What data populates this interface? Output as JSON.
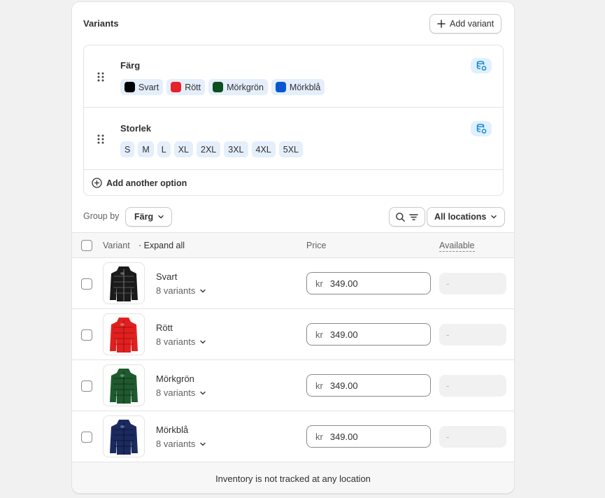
{
  "card": {
    "title": "Variants",
    "add_variant_label": "Add variant"
  },
  "options": [
    {
      "name": "Färg",
      "values": [
        {
          "label": "Svart",
          "color": "#000000"
        },
        {
          "label": "Rött",
          "color": "#e5232b"
        },
        {
          "label": "Mörkgrön",
          "color": "#0b4f1e"
        },
        {
          "label": "Mörkblå",
          "color": "#0b57d0"
        }
      ]
    },
    {
      "name": "Storlek",
      "values": [
        {
          "label": "S"
        },
        {
          "label": "M"
        },
        {
          "label": "L"
        },
        {
          "label": "XL"
        },
        {
          "label": "2XL"
        },
        {
          "label": "3XL"
        },
        {
          "label": "4XL"
        },
        {
          "label": "5XL"
        }
      ]
    }
  ],
  "add_option_label": "Add another option",
  "toolbar": {
    "group_by_label": "Group by",
    "group_by_value": "Färg",
    "locations_value": "All locations"
  },
  "table": {
    "col_variant": "Variant",
    "expand_all": "· Expand all",
    "col_price": "Price",
    "col_available": "Available",
    "rows": [
      {
        "name": "Svart",
        "variants": "8 variants",
        "currency": "kr",
        "price": "349.00",
        "available": "-",
        "jacket_color": "#1a1a1a"
      },
      {
        "name": "Rött",
        "variants": "8 variants",
        "currency": "kr",
        "price": "349.00",
        "available": "-",
        "jacket_color": "#e0201f"
      },
      {
        "name": "Mörkgrön",
        "variants": "8 variants",
        "currency": "kr",
        "price": "349.00",
        "available": "-",
        "jacket_color": "#1f5a2e"
      },
      {
        "name": "Mörkblå",
        "variants": "8 variants",
        "currency": "kr",
        "price": "349.00",
        "available": "-",
        "jacket_color": "#1b2a5e"
      }
    ]
  },
  "footer_text": "Inventory is not tracked at any location"
}
